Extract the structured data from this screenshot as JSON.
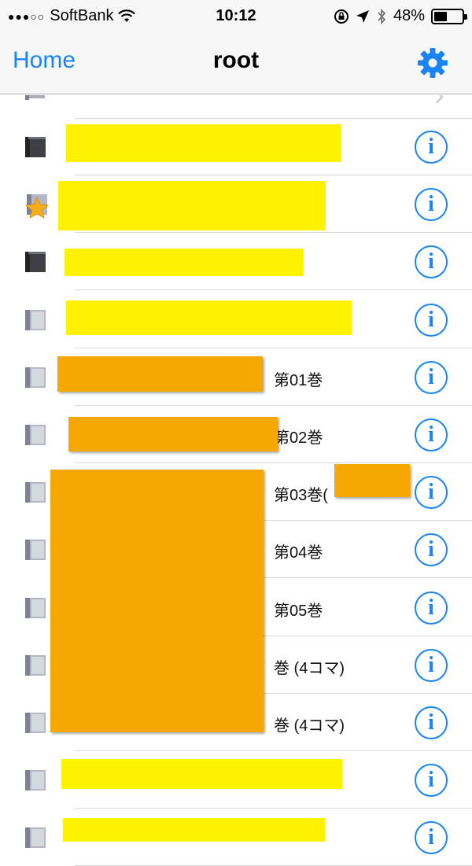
{
  "status_bar": {
    "signal": "●●●○○",
    "carrier": "SoftBank",
    "time": "10:12",
    "battery": "48%",
    "battery_level": 0.48
  },
  "nav": {
    "back_label": "Home",
    "title": "root"
  },
  "rows": [
    {
      "icon": "dark-book-icon",
      "label": ""
    },
    {
      "icon": "star-book-icon",
      "label": ""
    },
    {
      "icon": "dark-book-icon",
      "label": ""
    },
    {
      "icon": "book-icon",
      "label": ""
    },
    {
      "icon": "book-icon",
      "label": "第01巻"
    },
    {
      "icon": "book-icon",
      "label": "第02巻"
    },
    {
      "icon": "book-icon",
      "label": "第03巻("
    },
    {
      "icon": "book-icon",
      "label": "第04巻"
    },
    {
      "icon": "book-icon",
      "label": "第05巻"
    },
    {
      "icon": "book-icon",
      "label": "巻 (4コマ)"
    },
    {
      "icon": "book-icon",
      "label": "巻 (4コマ)"
    },
    {
      "icon": "book-icon",
      "label": ""
    },
    {
      "icon": "book-icon",
      "label": ""
    }
  ]
}
